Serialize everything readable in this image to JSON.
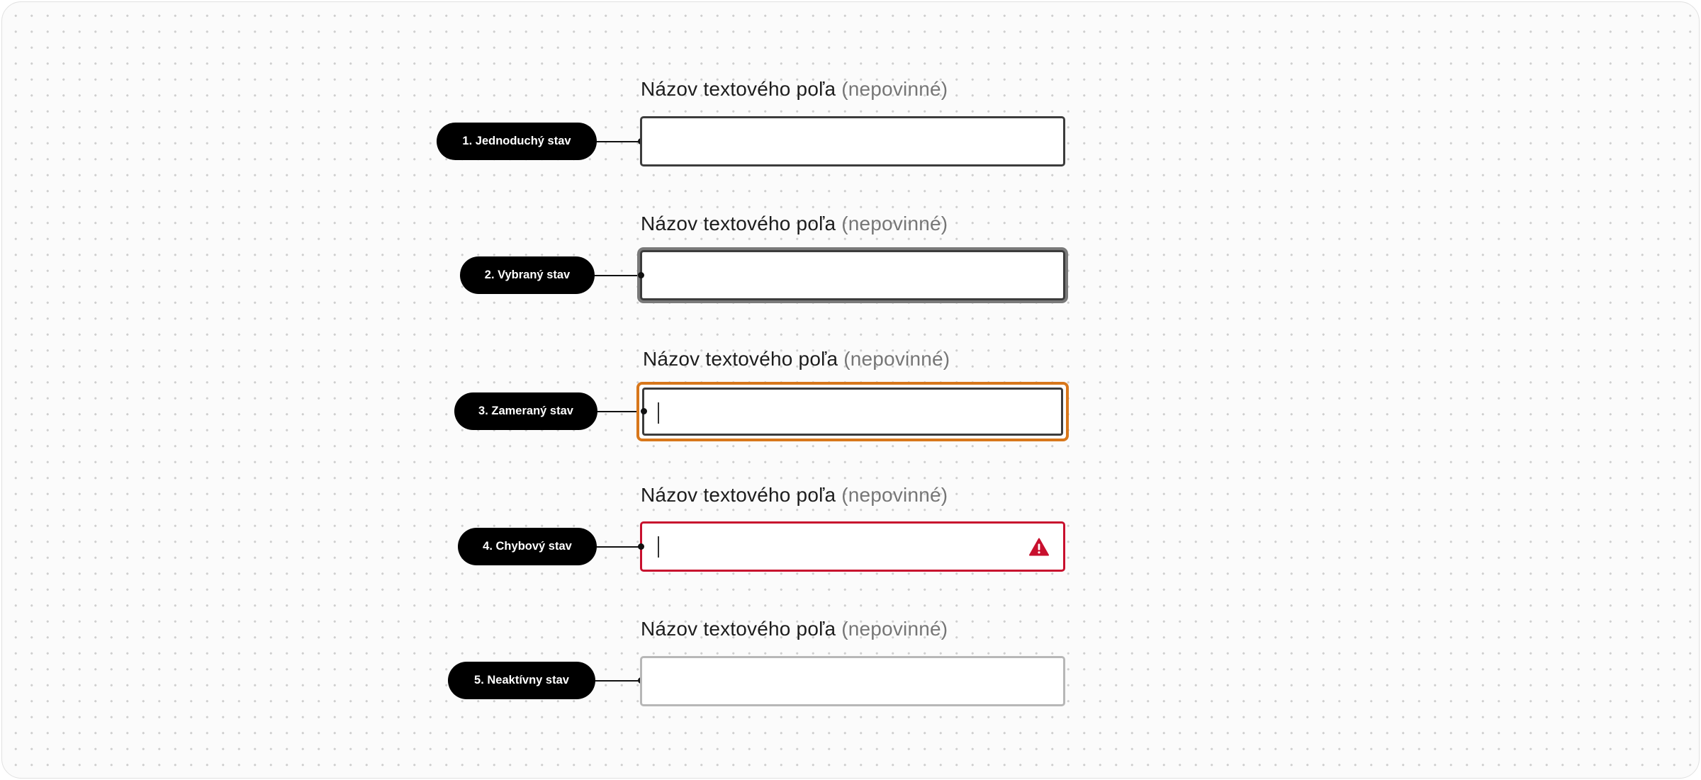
{
  "field_label": "Názov textového poľa",
  "field_optional": "(nepovinné)",
  "states": [
    {
      "name": "default",
      "badge": "1. Jednoduchý stav"
    },
    {
      "name": "selected",
      "badge": "2. Vybraný stav"
    },
    {
      "name": "focused",
      "badge": "3. Zameraný stav"
    },
    {
      "name": "error",
      "badge": "4. Chybový stav"
    },
    {
      "name": "disabled",
      "badge": "5. Neaktívny stav"
    }
  ],
  "colors": {
    "focus": "#d8771b",
    "error": "#c8102e",
    "border": "#3c3c3c",
    "disabled_border": "#b7b7b7",
    "selected_halo": "#7a7a7a"
  },
  "icons": {
    "error": "warning-triangle-icon"
  }
}
